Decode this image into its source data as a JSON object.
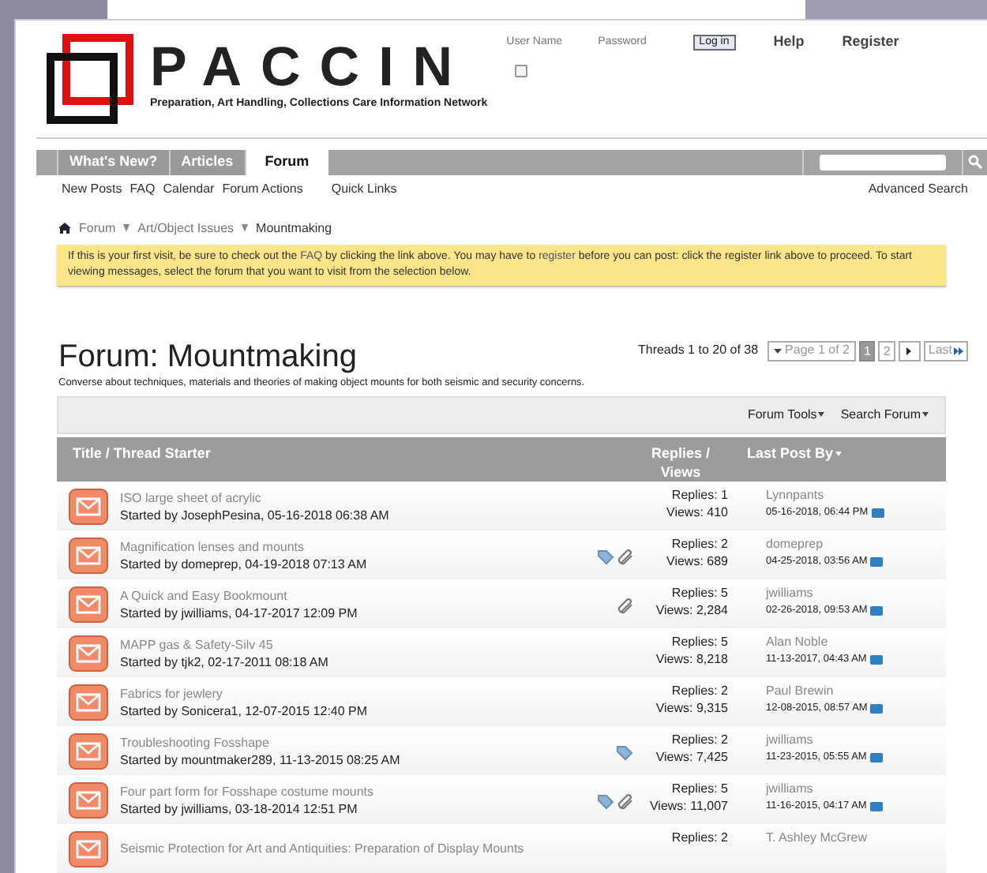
{
  "header": {
    "site_name": "PACCIN",
    "tagline": "Preparation, Art Handling, Collections Care Information Network",
    "login": {
      "user_name_label": "User Name",
      "password_label": "Password",
      "remember_checked": false,
      "login_button": "Log in"
    },
    "links": [
      "Help",
      "Register"
    ]
  },
  "nav": {
    "tabs": [
      {
        "label": "What's New?",
        "selected": false
      },
      {
        "label": "Articles",
        "selected": false
      },
      {
        "label": "Forum",
        "selected": true
      }
    ],
    "sublinks": [
      "New Posts",
      "FAQ",
      "Calendar",
      "Forum Actions",
      "Quick Links"
    ],
    "advanced_search": "Advanced Search"
  },
  "breadcrumb": [
    "Forum",
    "Art/Object Issues",
    "Mountmaking"
  ],
  "notice": {
    "before_faq": "If this is your first visit, be sure to check out the ",
    "faq_link": "FAQ",
    "middle": " by clicking the link above. You may have to ",
    "register_link": "register",
    "after": " before you can post: click the register link above to proceed. To start viewing messages, select the forum that you want to visit from the selection below."
  },
  "pagination": {
    "summary": "Threads 1 to 20 of 38",
    "page_menu": "Page 1 of 2",
    "pages": [
      {
        "label": "1",
        "selected": true
      },
      {
        "label": "2",
        "selected": false
      }
    ],
    "last": "Last"
  },
  "forum": {
    "title": "Forum: Mountmaking",
    "description": "Converse about techniques, materials and theories of making object mounts for both seismic and security concerns."
  },
  "toolbar": [
    "Forum Tools",
    "Search Forum"
  ],
  "table": {
    "columns": [
      "Title / Thread Starter",
      "Replies / Views",
      "Last Post By"
    ],
    "rows": [
      {
        "title": "ISO large sheet of acrylic",
        "starter": "Started by JosephPesina, 05-16-2018 06:38 AM",
        "tagged": false,
        "attachment": false,
        "replies": "Replies: 1",
        "views": "Views: 410",
        "last_user": "Lynnpants",
        "last_date": "05-16-2018, 06:44 PM"
      },
      {
        "title": "Magnification lenses and mounts",
        "starter": "Started by domeprep, 04-19-2018 07:13 AM",
        "tagged": true,
        "attachment": true,
        "replies": "Replies: 2",
        "views": "Views: 689",
        "last_user": "domeprep",
        "last_date": "04-25-2018, 03:56 AM"
      },
      {
        "title": "A Quick and Easy Bookmount",
        "starter": "Started by jwilliams, 04-17-2017 12:09 PM",
        "tagged": false,
        "attachment": true,
        "replies": "Replies: 5",
        "views": "Views: 2,284",
        "last_user": "jwilliams",
        "last_date": "02-26-2018, 09:53 AM"
      },
      {
        "title": "MAPP gas & Safety-Silv 45",
        "starter": "Started by tjk2, 02-17-2011 08:18 AM",
        "tagged": false,
        "attachment": false,
        "replies": "Replies: 5",
        "views": "Views: 8,218",
        "last_user": "Alan Noble",
        "last_date": "11-13-2017, 04:43 AM"
      },
      {
        "title": "Fabrics for jewlery",
        "starter": "Started by Sonicera1, 12-07-2015 12:40 PM",
        "tagged": false,
        "attachment": false,
        "replies": "Replies: 2",
        "views": "Views: 9,315",
        "last_user": "Paul Brewin",
        "last_date": "12-08-2015, 08:57 AM"
      },
      {
        "title": "Troubleshooting Fosshape",
        "starter": "Started by mountmaker289, 11-13-2015 08:25 AM",
        "tagged": true,
        "attachment": false,
        "replies": "Replies: 2",
        "views": "Views: 7,425",
        "last_user": "jwilliams",
        "last_date": "11-23-2015, 05:55 AM"
      },
      {
        "title": "Four part form for Fosshape costume mounts",
        "starter": "Started by jwilliams, 03-18-2014 12:51 PM",
        "tagged": true,
        "attachment": true,
        "replies": "Replies: 5",
        "views": "Views: 11,007",
        "last_user": "jwilliams",
        "last_date": "11-16-2015, 04:17 AM"
      },
      {
        "title": "Seismic Protection for Art and Antiquities: Preparation of Display Mounts",
        "replies": "Replies: 2",
        "last_user": "T. Ashley McGrew"
      }
    ]
  }
}
